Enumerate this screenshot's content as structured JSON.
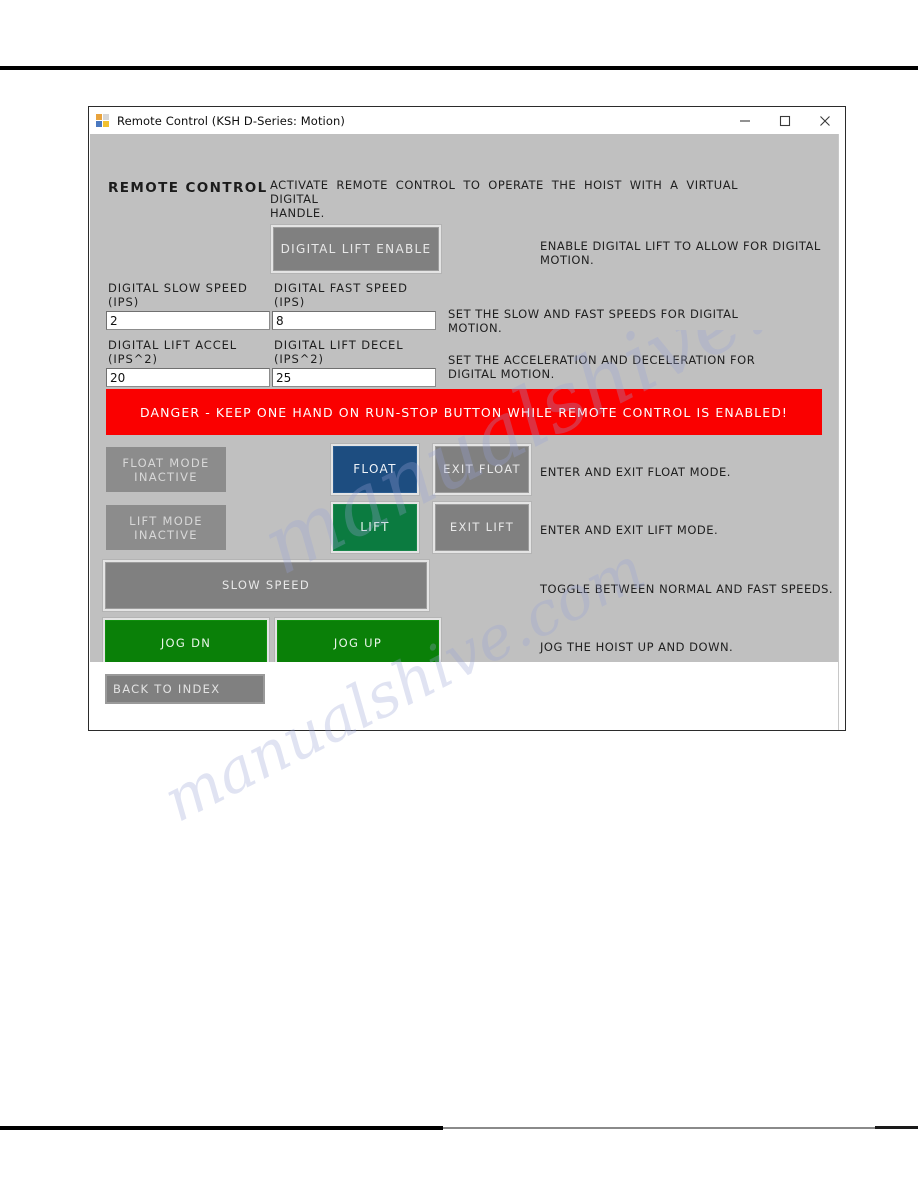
{
  "window": {
    "title": "Remote Control (KSH D-Series: Motion)",
    "icon": "app-icon",
    "minimize_label": "minimize-icon",
    "maximize_label": "maximize-icon",
    "close_label": "close-icon"
  },
  "section": {
    "title": "REMOTE CONTROL",
    "description": "ACTIVATE REMOTE CONTROL TO OPERATE THE HOIST WITH A VIRTUAL DIGITAL HANDLE.",
    "description_line1": "ACTIVATE REMOTE CONTROL TO OPERATE THE HOIST WITH A VIRTUAL DIGITAL",
    "description_line2": "HANDLE."
  },
  "digital_lift": {
    "button_label": "DIGITAL LIFT ENABLE",
    "description": "ENABLE DIGITAL LIFT TO ALLOW FOR DIGITAL MOTION."
  },
  "fields": [
    {
      "label": "DIGITAL SLOW SPEED\n(IPS)",
      "value": "2",
      "placeholder": ""
    },
    {
      "label": "DIGITAL FAST SPEED\n(IPS)",
      "value": "8",
      "placeholder": ""
    },
    {
      "label": "DIGITAL LIFT ACCEL\n(IPS^2)",
      "value": "20",
      "placeholder": ""
    },
    {
      "label": "DIGITAL LIFT DECEL\n(IPS^2)",
      "value": "25",
      "placeholder": ""
    }
  ],
  "field_descriptions": {
    "speeds": "SET THE SLOW AND FAST SPEEDS FOR DIGITAL MOTION.",
    "accels": "SET THE ACCELERATION AND DECELERATION FOR DIGITAL MOTION."
  },
  "danger": {
    "text": "DANGER - KEEP ONE HAND ON RUN-STOP BUTTON WHILE REMOTE CONTROL IS ENABLED!",
    "background_color": "#FA0000",
    "text_color": "#FFFFFF"
  },
  "float_row": {
    "status_label": "FLOAT MODE INACTIVE",
    "enter_label": "FLOAT",
    "exit_label": "EXIT FLOAT",
    "description": "ENTER AND EXIT FLOAT MODE.",
    "enter_color": "#1D4D80"
  },
  "lift_row": {
    "status_label": "LIFT MODE INACTIVE",
    "enter_label": "LIFT",
    "exit_label": "EXIT LIFT",
    "description": "ENTER AND EXIT LIFT MODE.",
    "enter_color": "#0B7B40"
  },
  "speed_toggle": {
    "label": "SLOW SPEED",
    "description": "TOGGLE BETWEEN NORMAL AND FAST SPEEDS."
  },
  "jog": {
    "down_label": "JOG DN",
    "up_label": "JOG UP",
    "description": "JOG THE HOIST UP AND DOWN.",
    "color": "#0A8008"
  },
  "navigation": {
    "back_label": "BACK TO INDEX"
  },
  "watermark": {
    "line1": "manualshive.com",
    "line2": "manualshive.com"
  },
  "colors": {
    "panel_background": "#C0C0C0",
    "button_gray": "#808080",
    "status_gray": "#8C8C8C",
    "danger_red": "#FA0000",
    "float_blue": "#1D4D80",
    "lift_green": "#0B7B40",
    "jog_green": "#0A8008"
  }
}
